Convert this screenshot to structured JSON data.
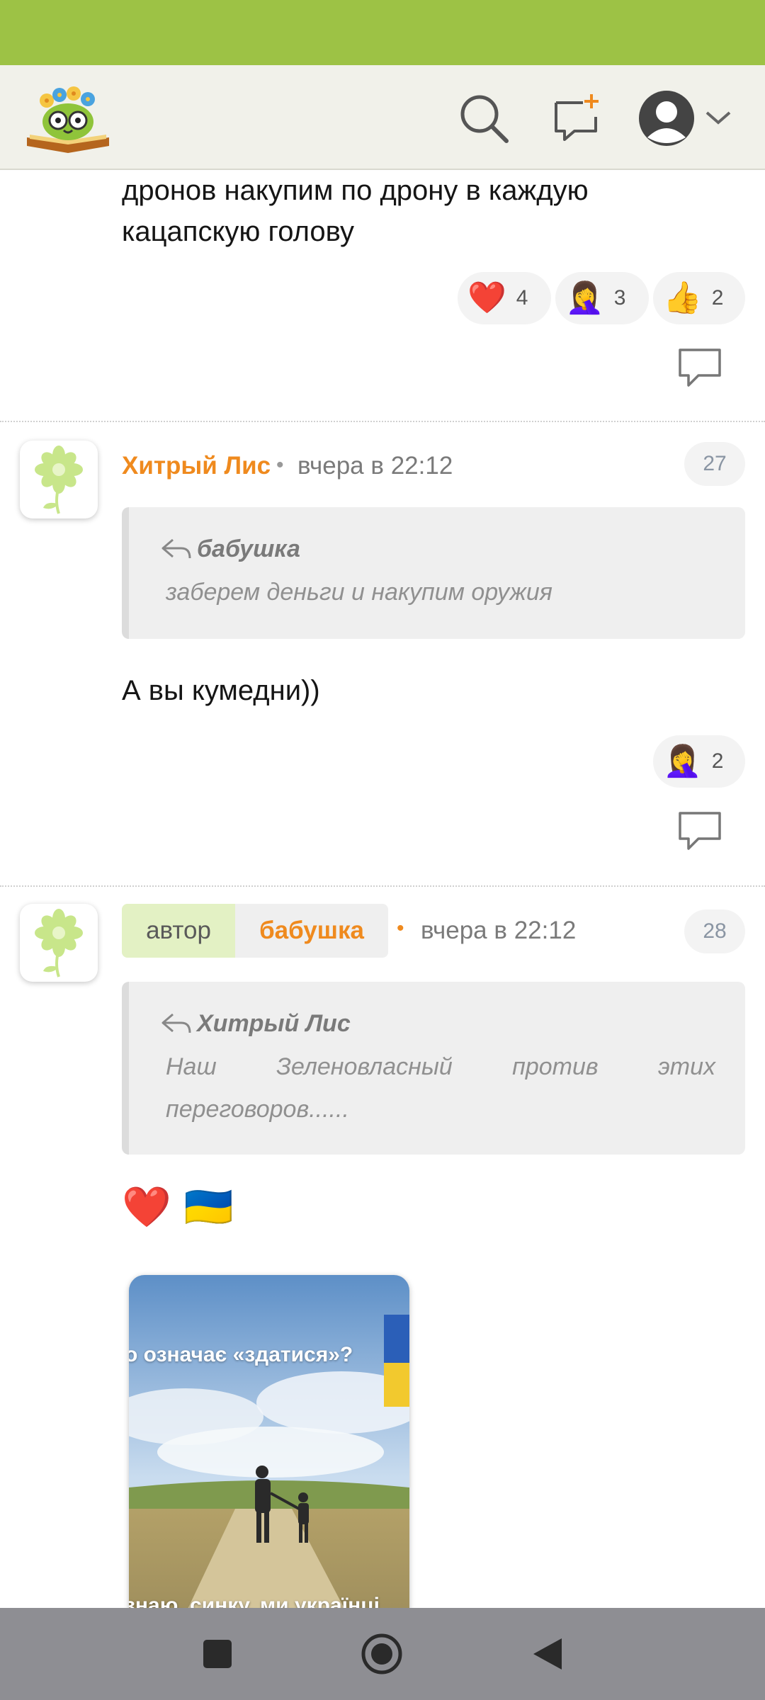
{
  "header": {
    "logo": "book-owl-logo",
    "icons": [
      "search-icon",
      "new-message-icon",
      "user-avatar-icon",
      "chevron-down-icon"
    ]
  },
  "posts": [
    {
      "text_lines": [
        "дронов накупим по дрону в каждую",
        "кацапскую голову"
      ],
      "reactions": [
        {
          "emoji": "❤️",
          "count": "4"
        },
        {
          "emoji": "🤦‍♀️",
          "count": "3"
        },
        {
          "emoji": "👍",
          "count": "2"
        }
      ]
    },
    {
      "author": "Хитрый Лис",
      "separator": "•",
      "time": "вчера в 22:12",
      "number": "27",
      "quote": {
        "author": "бабушка",
        "text": "заберем деньги и накупим оружия"
      },
      "text": "А вы кумедни))",
      "reactions": [
        {
          "emoji": "🤦‍♀️",
          "count": "2"
        }
      ]
    },
    {
      "badge_label": "автор",
      "author": "бабушка",
      "separator": "•",
      "time": "вчера в 22:12",
      "number": "28",
      "quote": {
        "author": "Хитрый Лис",
        "text": "Наш Зеленовласный против этих переговоров......"
      },
      "text": "❤️ 🇺🇦",
      "image": {
        "top_text": "о означає «здатися»?",
        "bottom_text": "знаю, синку. ми українці"
      }
    }
  ],
  "nav": {
    "icons": [
      "recent-apps-icon",
      "home-icon",
      "back-icon"
    ]
  },
  "colors": {
    "status_bar": "#9dc245",
    "username": "#ef8a1e",
    "author_tag_bg": "#e3f1c4"
  }
}
